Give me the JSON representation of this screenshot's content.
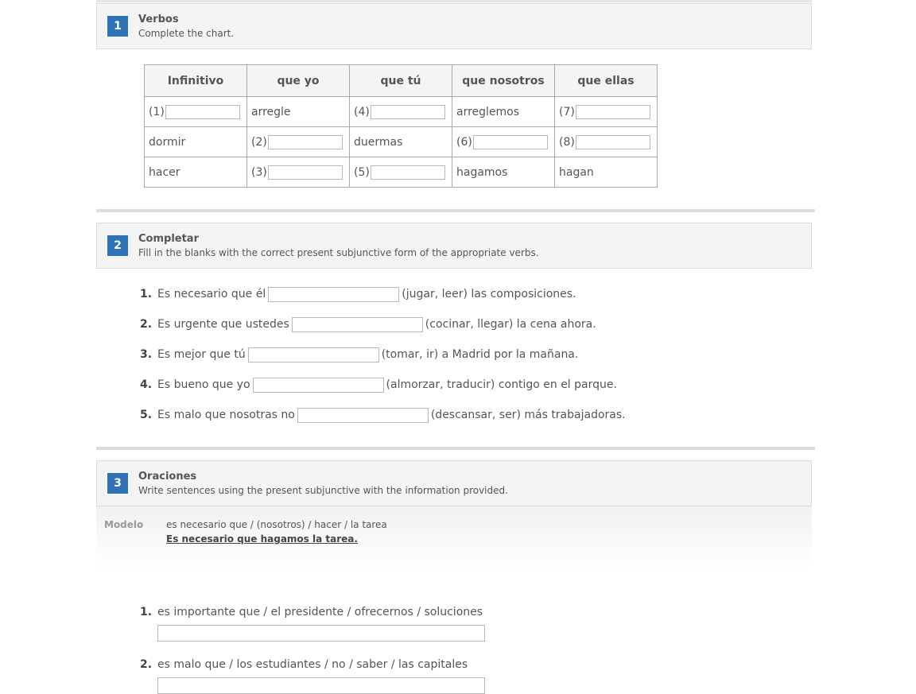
{
  "section1": {
    "number": "1",
    "title": "Verbos",
    "instruction": "Complete the chart.",
    "headers": [
      "Infinitivo",
      "que yo",
      "que tú",
      "que nosotros",
      "que ellas"
    ],
    "rows": [
      [
        {
          "num": "(1)",
          "input": true
        },
        {
          "text": "arregle"
        },
        {
          "num": "(4)",
          "input": true
        },
        {
          "text": "arreglemos"
        },
        {
          "num": "(7)",
          "input": true
        }
      ],
      [
        {
          "text": "dormir"
        },
        {
          "num": "(2)",
          "input": true
        },
        {
          "text": "duermas"
        },
        {
          "num": "(6)",
          "input": true
        },
        {
          "num": "(8)",
          "input": true
        }
      ],
      [
        {
          "text": "hacer"
        },
        {
          "num": "(3)",
          "input": true
        },
        {
          "num": "(5)",
          "input": true
        },
        {
          "text": "hagamos"
        },
        {
          "text": "hagan"
        }
      ]
    ]
  },
  "section2": {
    "number": "2",
    "title": "Completar",
    "instruction": "Fill in the blanks with the correct present subjunctive form of the appropriate verbs.",
    "items": [
      {
        "num": "1.",
        "before": "Es necesario que él",
        "after": "(jugar, leer) las composiciones."
      },
      {
        "num": "2.",
        "before": "Es urgente que ustedes",
        "after": "(cocinar, llegar) la cena ahora."
      },
      {
        "num": "3.",
        "before": "Es mejor que tú",
        "after": "(tomar, ir) a Madrid por la mañana."
      },
      {
        "num": "4.",
        "before": "Es bueno que yo",
        "after": "(almorzar, traducir) contigo en el parque."
      },
      {
        "num": "5.",
        "before": "Es malo que nosotras no",
        "after": "(descansar, ser) más trabajadoras."
      }
    ]
  },
  "section3": {
    "number": "3",
    "title": "Oraciones",
    "instruction": "Write sentences using the present subjunctive with the information provided.",
    "modelo": {
      "label": "Modelo",
      "prompt": "es necesario que / (nosotros) / hacer / la tarea",
      "answer": "Es necesario que hagamos la tarea."
    },
    "items": [
      {
        "num": "1.",
        "prompt": "es importante que / el presidente / ofrecernos / soluciones"
      },
      {
        "num": "2.",
        "prompt": "es malo que / los estudiantes / no / saber / las capitales"
      }
    ]
  },
  "colors": {
    "badge": "#2e72b8",
    "header_bg": "#f4f4f4",
    "border": "#aaaaaa"
  }
}
